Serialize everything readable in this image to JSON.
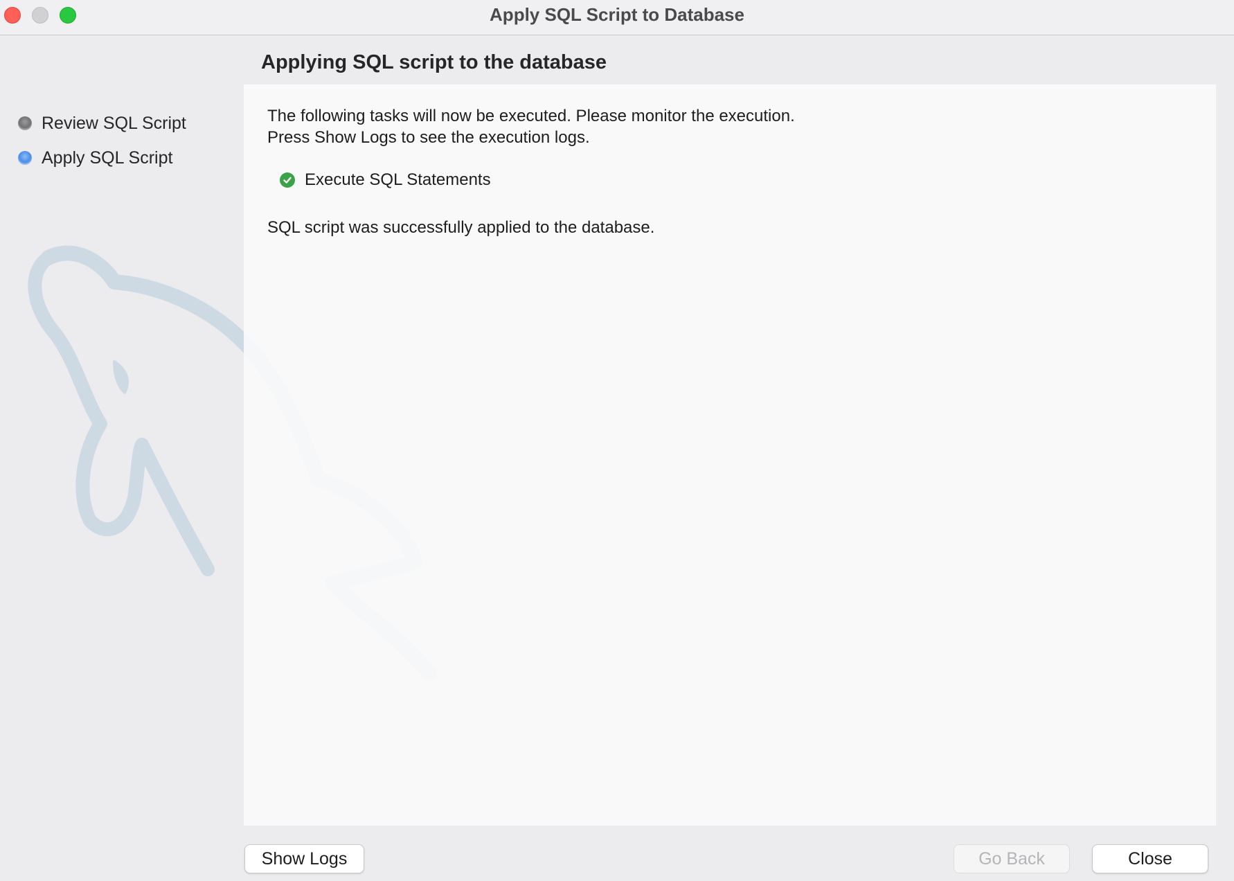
{
  "window": {
    "title": "Apply SQL Script to Database"
  },
  "sidebar": {
    "steps": [
      {
        "label": "Review SQL Script",
        "state": "done"
      },
      {
        "label": "Apply SQL Script",
        "state": "active"
      }
    ]
  },
  "main": {
    "heading": "Applying SQL script to the database",
    "intro_line1": "The following tasks will now be executed. Please monitor the execution.",
    "intro_line2": "Press Show Logs to see the execution logs.",
    "tasks": [
      {
        "label": "Execute SQL Statements",
        "status": "success",
        "icon": "check-circle-icon"
      }
    ],
    "result_message": "SQL script was successfully applied to the database."
  },
  "footer": {
    "show_logs_label": "Show Logs",
    "go_back_label": "Go Back",
    "go_back_enabled": false,
    "close_label": "Close"
  },
  "colors": {
    "accent_blue": "#3f86e6",
    "success_green": "#3aa348",
    "traffic_close": "#fe5f57",
    "traffic_zoom": "#28c840"
  }
}
